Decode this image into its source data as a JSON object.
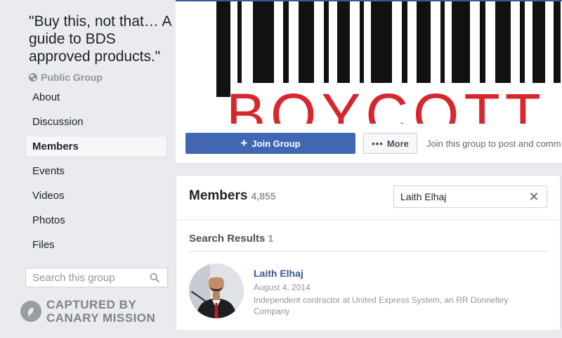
{
  "group": {
    "title": "\"Buy this, not that… A guide to BDS approved products.\"",
    "privacy": "Public Group"
  },
  "sidebar": {
    "items": [
      {
        "label": "About"
      },
      {
        "label": "Discussion"
      },
      {
        "label": "Members",
        "active": true
      },
      {
        "label": "Events"
      },
      {
        "label": "Videos"
      },
      {
        "label": "Photos"
      },
      {
        "label": "Files"
      }
    ],
    "search_placeholder": "Search this group"
  },
  "watermark": {
    "line1": "CAPTURED BY",
    "line2": "CANARY MISSION"
  },
  "cover": {
    "text": "BOYCOTT",
    "text_color": "#d7262c",
    "bar_color": "#111111"
  },
  "actions": {
    "join_label": "Join Group",
    "more_label": "More",
    "hint": "Join this group to post and comm"
  },
  "members": {
    "title": "Members",
    "count": "4,855",
    "search_value": "Laith Elhaj",
    "results_label": "Search Results",
    "results_count": "1",
    "results": [
      {
        "name": "Laith Elhaj",
        "date": "August 4, 2014",
        "bio": "Independent contractor at United Express System, an RR Donnelley Company"
      }
    ]
  },
  "colors": {
    "primary": "#4267b2",
    "link": "#365899",
    "background": "#e9ebee",
    "muted": "#90949c"
  },
  "icons": [
    "globe-icon",
    "search-icon",
    "clear-icon",
    "plus-icon",
    "more-dots-icon",
    "canary-logo"
  ]
}
